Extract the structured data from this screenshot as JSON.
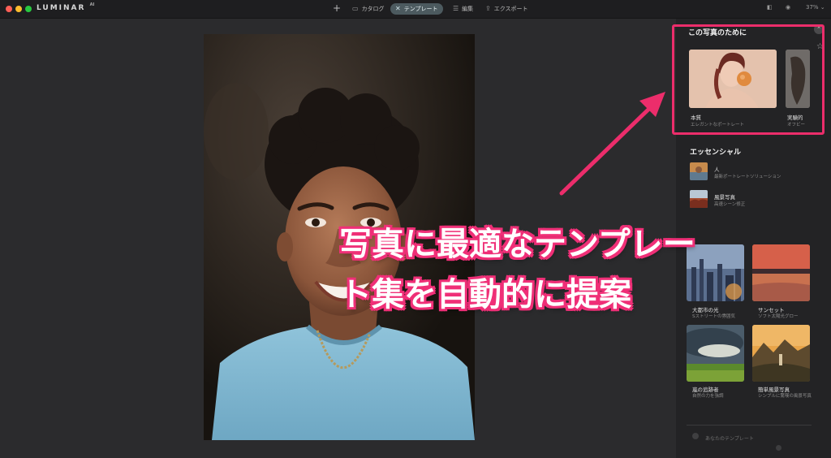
{
  "app": {
    "brand": "LUMINAR",
    "version": "AI"
  },
  "toolbar": {
    "catalog_label": "カタログ",
    "template_label": "テンプレート",
    "edit_label": "編集",
    "export_label": "エクスポート",
    "zoom_label": "37% ⌄"
  },
  "panel": {
    "for_photo_title": "この写真のために",
    "for_photo_cards": [
      {
        "title": "本質",
        "sub": "エレガントなポートレート"
      },
      {
        "title": "実験的",
        "sub": "オフビー"
      }
    ],
    "essential_title": "エッセンシャル",
    "essential_items": [
      {
        "title": "人",
        "sub": "最新ポートレートソリューション"
      },
      {
        "title": "風景写真",
        "sub": "高速シーン修正"
      }
    ],
    "grid_cards": [
      {
        "title": "大都市の光",
        "sub": "Sストリートの雰囲気"
      },
      {
        "title": "サンセット",
        "sub": "ソフト太陽光グロー"
      },
      {
        "title": "嵐の追跡者",
        "sub": "自然の力を強調"
      },
      {
        "title": "簡単風景写真",
        "sub": "シンプルに驚嘆の風景写真"
      }
    ],
    "my_templates_label": "あなたのテンプレート"
  },
  "annotation": {
    "line1": "写真に最適なテンプレー",
    "line2": "ト集を自動的に提案",
    "color": "#ec2d6b"
  }
}
